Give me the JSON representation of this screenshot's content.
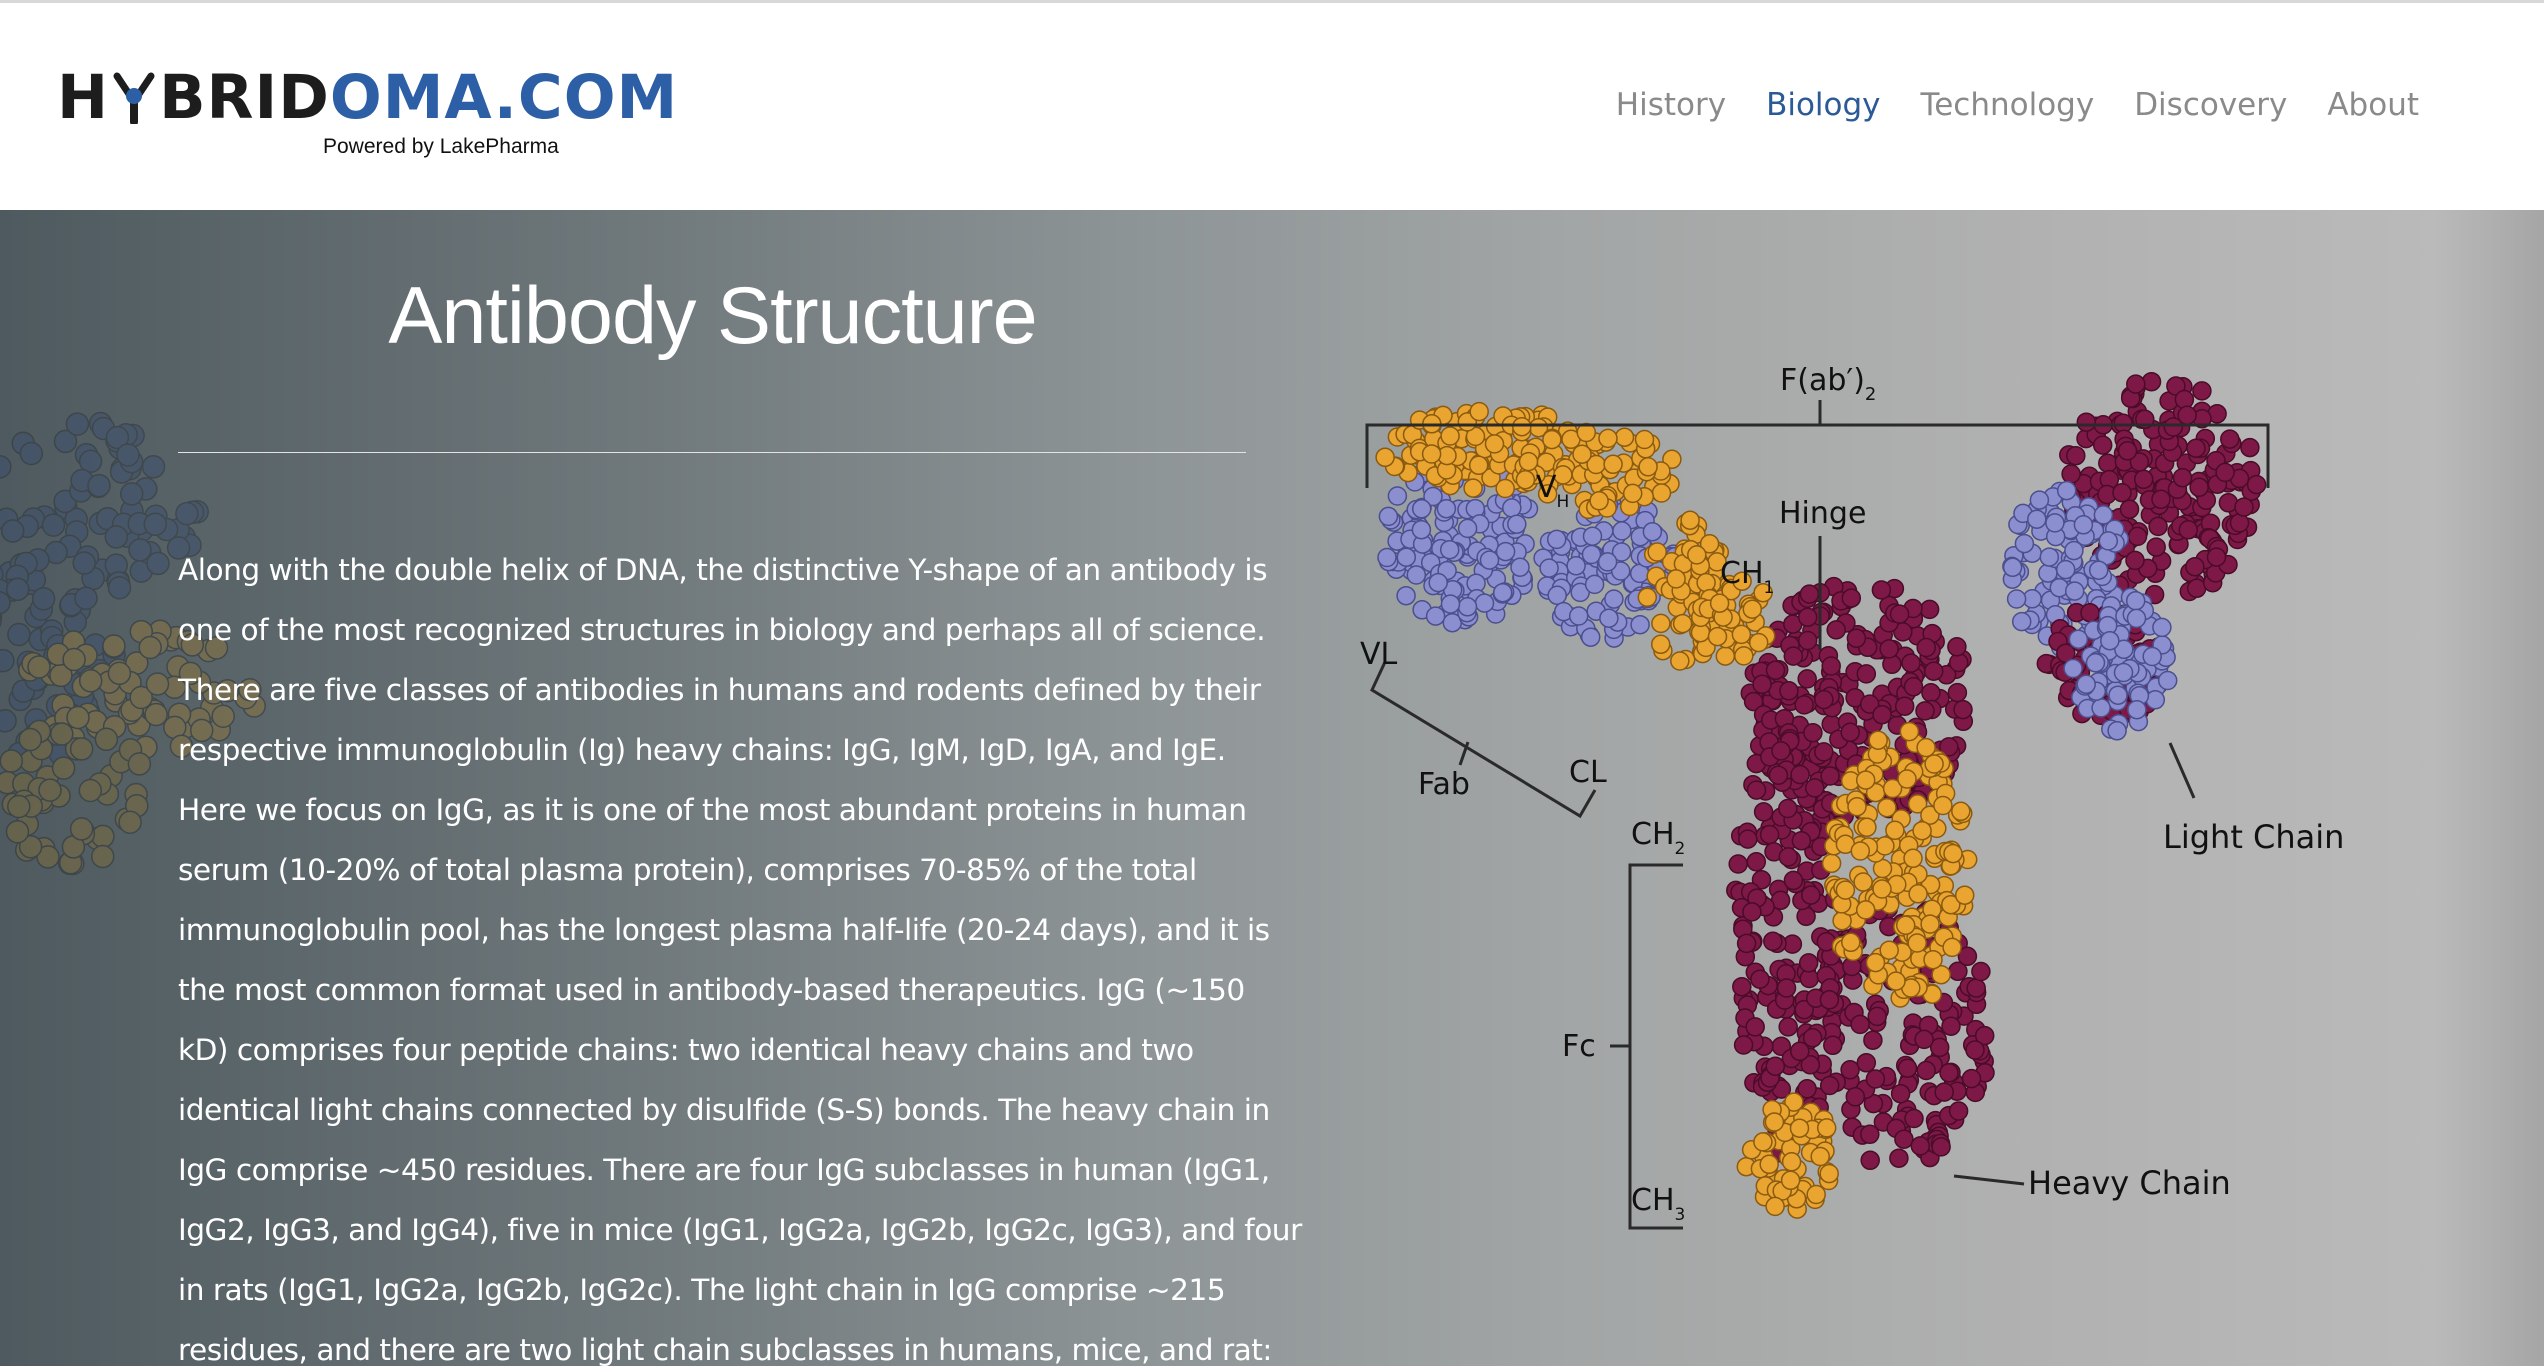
{
  "site": {
    "logo_prefix": "H",
    "logo_brid": "BRID",
    "logo_oma": "OMA.COM",
    "logo_tagline": "Powered by LakePharma"
  },
  "nav": {
    "items": [
      {
        "label": "History",
        "active": false
      },
      {
        "label": "Biology",
        "active": true
      },
      {
        "label": "Technology",
        "active": false
      },
      {
        "label": "Discovery",
        "active": false
      },
      {
        "label": "About",
        "active": false
      }
    ]
  },
  "colors": {
    "brand_blue": "#2d5fa6",
    "nav_active": "#2b5a96",
    "heavy_chain": "#7e1847",
    "light_chain_light_region": "#8b8fcf",
    "variable_region": "#e9a530"
  },
  "page": {
    "title": "Antibody Structure",
    "paragraph_lines": [
      "Along with the double helix of DNA, the distinctive Y-shape of an antibody is",
      "one of the most recognized structures in biology and perhaps all of science.",
      "There are five classes of antibodies in humans and rodents defined by their",
      "respective immunoglobulin (Ig) heavy chains:  IgG, IgM, IgD, IgA, and IgE.",
      "Here we focus on IgG, as it is one of the most abundant proteins in human",
      "serum (10-20% of total plasma protein), comprises 70-85% of the total",
      "immunoglobulin pool, has the longest plasma half-life (20-24 days), and it is",
      "the most common format used in antibody-based therapeutics.  IgG (~150",
      "kD) comprises four peptide chains: two identical heavy chains and two",
      "identical light chains connected by disulfide (S-S) bonds.  The heavy chain in",
      "IgG comprise ~450 residues.  There are four IgG subclasses in human (IgG1,",
      "IgG2, IgG3, and IgG4), five in mice (IgG1, IgG2a, IgG2b, IgG2c, IgG3), and four",
      "in rats (IgG1, IgG2a, IgG2b, IgG2c).  The light chain in IgG comprise ~215",
      "residues, and there are two light chain subclasses in humans, mice, and rat:"
    ]
  },
  "diagram": {
    "fab2_label": "F(ab′)",
    "fab2_sub": "2",
    "hinge_label": "Hinge",
    "vh_label": "V",
    "vh_sub": "H",
    "ch1_label": "CH",
    "ch1_sub": "1",
    "vl_label": "VL",
    "cl_label": "CL",
    "fab_label": "Fab",
    "ch2_label": "CH",
    "ch2_sub": "2",
    "fc_label": "Fc",
    "ch3_label": "CH",
    "ch3_sub": "3",
    "light_chain_label": "Light Chain",
    "heavy_chain_label": "Heavy Chain"
  }
}
